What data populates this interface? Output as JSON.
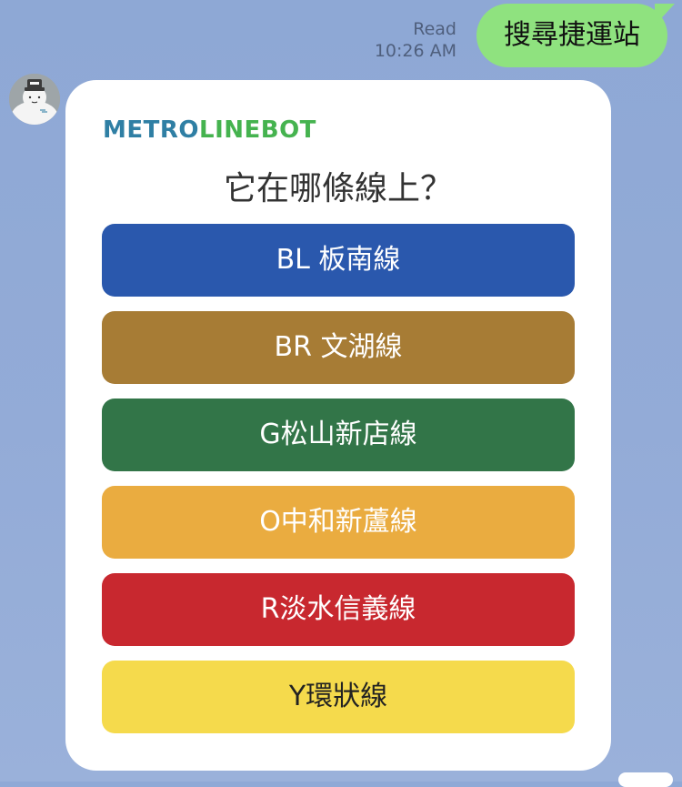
{
  "outgoing": {
    "status": "Read",
    "time": "10:26 AM",
    "text": "搜尋捷運站"
  },
  "bot": {
    "avatar_icon": "snowman-bot-avatar"
  },
  "card": {
    "brand_part1": "METRO",
    "brand_part2": "LINEBOT",
    "brand_colors": {
      "part1": "#2f7fa4",
      "part2": "#45b34f"
    },
    "question": "它在哪條線上？",
    "lines": [
      {
        "label": "BL 板南線",
        "color": "#2a58ad"
      },
      {
        "label": "BR 文湖線",
        "color": "#a77c35"
      },
      {
        "label": "G松山新店線",
        "color": "#327548"
      },
      {
        "label": "O中和新蘆線",
        "color": "#eaac40"
      },
      {
        "label": "R淡水信義線",
        "color": "#c8282f"
      },
      {
        "label": "Y環狀線",
        "color": "#f5da4c"
      }
    ]
  }
}
